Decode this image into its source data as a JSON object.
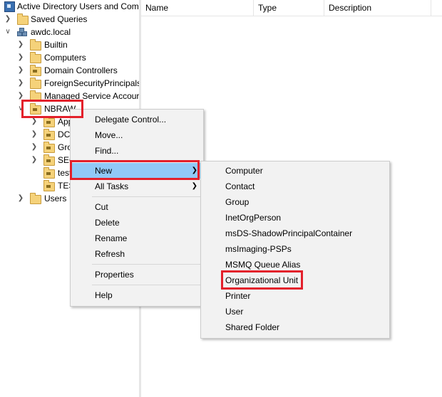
{
  "tree": {
    "root": "Active Directory Users and Com",
    "saved_queries": "Saved Queries",
    "domain": "awdc.local",
    "items": [
      "Builtin",
      "Computers",
      "Domain Controllers",
      "ForeignSecurityPrincipals",
      "Managed Service Accour"
    ],
    "selected": "NBRAW",
    "children": [
      "App",
      "DC",
      "Gro",
      "SEC",
      "test",
      "TES"
    ],
    "users": "Users"
  },
  "list_header": {
    "name": "Name",
    "type": "Type",
    "description": "Description"
  },
  "context_menu": {
    "items": [
      "Delegate Control...",
      "Move...",
      "Find...",
      "New",
      "All Tasks",
      "Cut",
      "Delete",
      "Rename",
      "Refresh",
      "Properties",
      "Help"
    ]
  },
  "new_submenu": {
    "items": [
      "Computer",
      "Contact",
      "Group",
      "InetOrgPerson",
      "msDS-ShadowPrincipalContainer",
      "msImaging-PSPs",
      "MSMQ Queue Alias",
      "Organizational Unit",
      "Printer",
      "User",
      "Shared Folder"
    ]
  },
  "colors": {
    "highlight": "#91c9f7",
    "annotation_box": "#e3202b",
    "menu_bg": "#f2f2f2"
  }
}
